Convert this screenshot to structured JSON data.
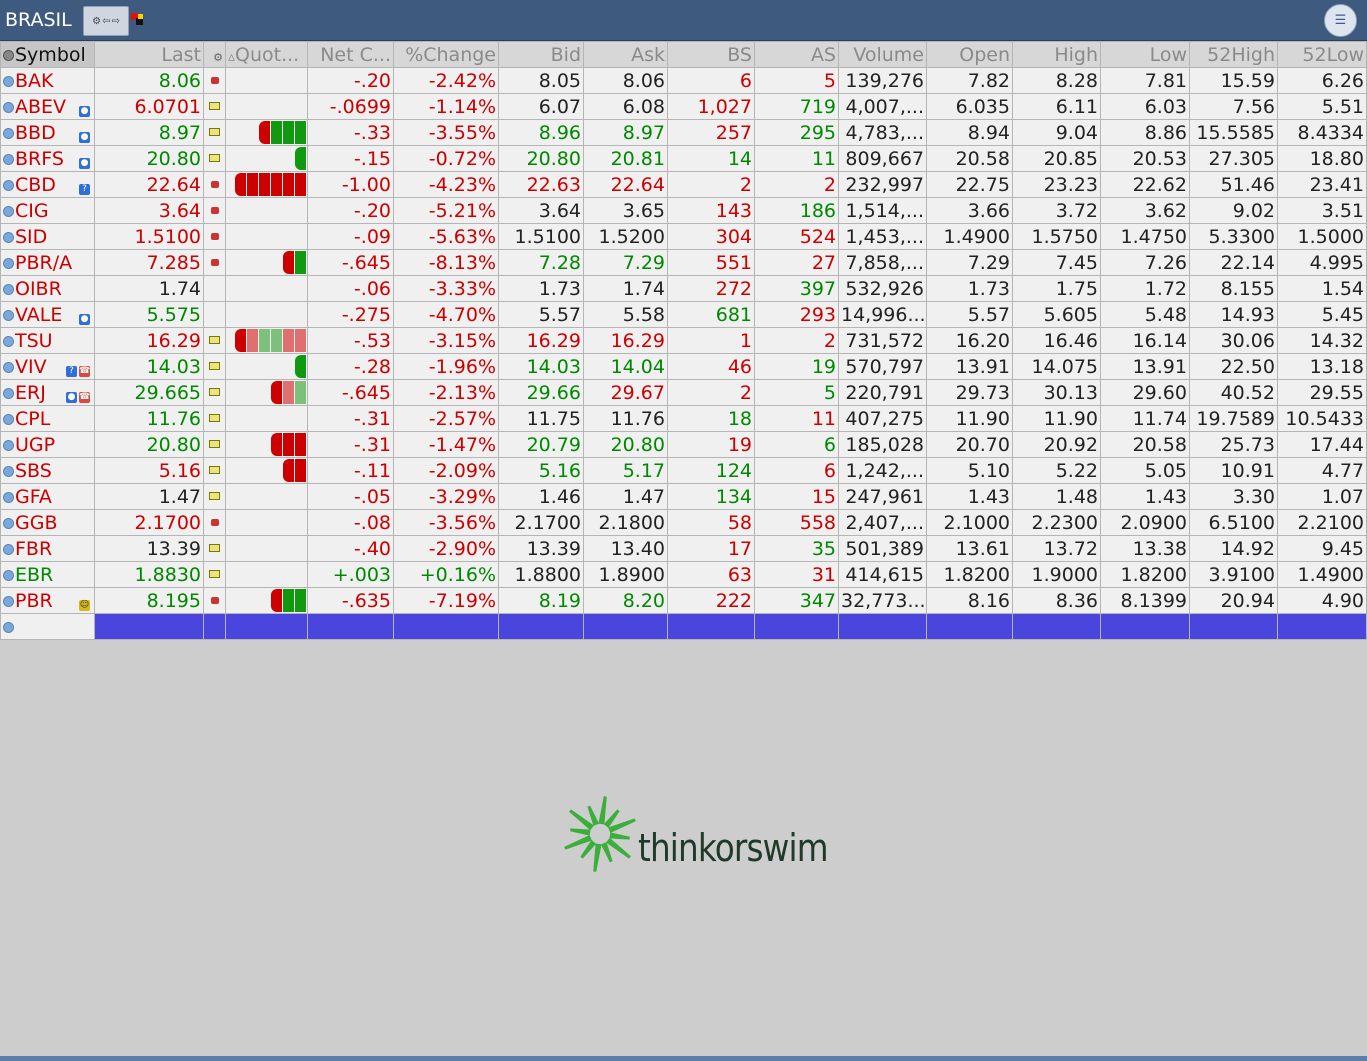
{
  "window": {
    "title": "BRASIL"
  },
  "brand": {
    "logo_text": "thinkorswim",
    "logo_green": "#3cae3c"
  },
  "colors": {
    "title_bar": "#3e5a7e",
    "up": "#008800",
    "down": "#cc0000",
    "selected_row": "#4a45dd"
  },
  "columns": [
    "Symbol",
    "Last",
    "",
    "Quot...",
    "Net C...",
    "%Change",
    "Bid",
    "Ask",
    "BS",
    "AS",
    "Volume",
    "Open",
    "High",
    "Low",
    "52High",
    "52Low"
  ],
  "rows": [
    {
      "symbol": "BAK",
      "sc": "r",
      "badges": [],
      "last": "8.06",
      "lc": "g",
      "rating": "red",
      "bars": [],
      "net": "-.20",
      "pct": "-2.42%",
      "bid": "8.05",
      "bidc": "k",
      "ask": "8.06",
      "askc": "k",
      "bs": "6",
      "bsc": "r",
      "as": "5",
      "asc": "r",
      "vol": "139,276",
      "open": "7.82",
      "high": "8.28",
      "low": "7.81",
      "h52": "15.59",
      "l52": "6.26"
    },
    {
      "symbol": "ABEV",
      "sc": "r",
      "badges": [
        "blue"
      ],
      "last": "6.0701",
      "lc": "r",
      "rating": "yellow",
      "bars": [],
      "net": "-.0699",
      "pct": "-1.14%",
      "bid": "6.07",
      "bidc": "k",
      "ask": "6.08",
      "askc": "k",
      "bs": "1,027",
      "bsc": "r",
      "as": "719",
      "asc": "g",
      "vol": "4,007,...",
      "open": "6.035",
      "high": "6.11",
      "low": "6.03",
      "h52": "7.56",
      "l52": "5.51"
    },
    {
      "symbol": "BBD",
      "sc": "r",
      "badges": [
        "blue"
      ],
      "last": "8.97",
      "lc": "g",
      "rating": "yellow",
      "bars": [
        "#cc0000",
        "#119911",
        "#119911",
        "#119911"
      ],
      "net": "-.33",
      "pct": "-3.55%",
      "bid": "8.96",
      "bidc": "g",
      "ask": "8.97",
      "askc": "g",
      "bs": "257",
      "bsc": "r",
      "as": "295",
      "asc": "g",
      "vol": "4,783,...",
      "open": "8.94",
      "high": "9.04",
      "low": "8.86",
      "h52": "15.5585",
      "l52": "8.4334"
    },
    {
      "symbol": "BRFS",
      "sc": "r",
      "badges": [
        "blue"
      ],
      "last": "20.80",
      "lc": "g",
      "rating": "yellow",
      "bars": [
        "#119911"
      ],
      "net": "-.15",
      "pct": "-0.72%",
      "bid": "20.80",
      "bidc": "g",
      "ask": "20.81",
      "askc": "g",
      "bs": "14",
      "bsc": "g",
      "as": "11",
      "asc": "g",
      "vol": "809,667",
      "open": "20.58",
      "high": "20.85",
      "low": "20.53",
      "h52": "27.305",
      "l52": "18.80"
    },
    {
      "symbol": "CBD",
      "sc": "r",
      "badges": [
        "blue-q"
      ],
      "last": "22.64",
      "lc": "r",
      "rating": "red",
      "bars": [
        "#cc0000",
        "#cc0000",
        "#cc0000",
        "#cc0000",
        "#cc0000",
        "#cc0000"
      ],
      "net": "-1.00",
      "pct": "-4.23%",
      "bid": "22.63",
      "bidc": "r",
      "ask": "22.64",
      "askc": "r",
      "bs": "2",
      "bsc": "r",
      "as": "2",
      "asc": "r",
      "vol": "232,997",
      "open": "22.75",
      "high": "23.23",
      "low": "22.62",
      "h52": "51.46",
      "l52": "23.41"
    },
    {
      "symbol": "CIG",
      "sc": "r",
      "badges": [],
      "last": "3.64",
      "lc": "r",
      "rating": "red",
      "bars": [],
      "net": "-.20",
      "pct": "-5.21%",
      "bid": "3.64",
      "bidc": "k",
      "ask": "3.65",
      "askc": "k",
      "bs": "143",
      "bsc": "r",
      "as": "186",
      "asc": "g",
      "vol": "1,514,...",
      "open": "3.66",
      "high": "3.72",
      "low": "3.62",
      "h52": "9.02",
      "l52": "3.51"
    },
    {
      "symbol": "SID",
      "sc": "r",
      "badges": [],
      "last": "1.5100",
      "lc": "r",
      "rating": "red",
      "bars": [],
      "net": "-.09",
      "pct": "-5.63%",
      "bid": "1.5100",
      "bidc": "k",
      "ask": "1.5200",
      "askc": "k",
      "bs": "304",
      "bsc": "r",
      "as": "524",
      "asc": "r",
      "vol": "1,453,...",
      "open": "1.4900",
      "high": "1.5750",
      "low": "1.4750",
      "h52": "5.3300",
      "l52": "1.5000"
    },
    {
      "symbol": "PBR/A",
      "sc": "r",
      "badges": [],
      "last": "7.285",
      "lc": "r",
      "rating": "red",
      "bars": [
        "#cc0000",
        "#119911"
      ],
      "net": "-.645",
      "pct": "-8.13%",
      "bid": "7.28",
      "bidc": "g",
      "ask": "7.29",
      "askc": "g",
      "bs": "551",
      "bsc": "r",
      "as": "27",
      "asc": "r",
      "vol": "7,858,...",
      "open": "7.29",
      "high": "7.45",
      "low": "7.26",
      "h52": "22.14",
      "l52": "4.995"
    },
    {
      "symbol": "OIBR",
      "sc": "r",
      "badges": [],
      "last": "1.74",
      "lc": "k",
      "rating": "",
      "bars": [],
      "net": "-.06",
      "pct": "-3.33%",
      "bid": "1.73",
      "bidc": "k",
      "ask": "1.74",
      "askc": "k",
      "bs": "272",
      "bsc": "r",
      "as": "397",
      "asc": "g",
      "vol": "532,926",
      "open": "1.73",
      "high": "1.75",
      "low": "1.72",
      "h52": "8.155",
      "l52": "1.54"
    },
    {
      "symbol": "VALE",
      "sc": "r",
      "badges": [
        "blue"
      ],
      "last": "5.575",
      "lc": "g",
      "rating": "",
      "bars": [],
      "net": "-.275",
      "pct": "-4.70%",
      "bid": "5.57",
      "bidc": "k",
      "ask": "5.58",
      "askc": "k",
      "bs": "681",
      "bsc": "g",
      "as": "293",
      "asc": "r",
      "vol": "14,996...",
      "open": "5.57",
      "high": "5.605",
      "low": "5.48",
      "h52": "14.93",
      "l52": "5.45"
    },
    {
      "symbol": "TSU",
      "sc": "r",
      "badges": [],
      "last": "16.29",
      "lc": "r",
      "rating": "yellow",
      "bars": [
        "#cc0000",
        "#e07070",
        "#7cc07c",
        "#7cc07c",
        "#e07070",
        "#e07070"
      ],
      "net": "-.53",
      "pct": "-3.15%",
      "bid": "16.29",
      "bidc": "r",
      "ask": "16.29",
      "askc": "r",
      "bs": "1",
      "bsc": "r",
      "as": "2",
      "asc": "r",
      "vol": "731,572",
      "open": "16.20",
      "high": "16.46",
      "low": "16.14",
      "h52": "30.06",
      "l52": "14.32"
    },
    {
      "symbol": "VIV",
      "sc": "r",
      "badges": [
        "blue-q",
        "red"
      ],
      "last": "14.03",
      "lc": "g",
      "rating": "yellow",
      "bars": [
        "#119911"
      ],
      "net": "-.28",
      "pct": "-1.96%",
      "bid": "14.03",
      "bidc": "g",
      "ask": "14.04",
      "askc": "g",
      "bs": "46",
      "bsc": "r",
      "as": "19",
      "asc": "g",
      "vol": "570,797",
      "open": "13.91",
      "high": "14.075",
      "low": "13.91",
      "h52": "22.50",
      "l52": "13.18"
    },
    {
      "symbol": "ERJ",
      "sc": "r",
      "badges": [
        "blue",
        "red"
      ],
      "last": "29.665",
      "lc": "g",
      "rating": "yellow",
      "bars": [
        "#cc0000",
        "#e07070",
        "#7cc07c"
      ],
      "net": "-.645",
      "pct": "-2.13%",
      "bid": "29.66",
      "bidc": "g",
      "ask": "29.67",
      "askc": "r",
      "bs": "2",
      "bsc": "r",
      "as": "5",
      "asc": "g",
      "vol": "220,791",
      "open": "29.73",
      "high": "30.13",
      "low": "29.60",
      "h52": "40.52",
      "l52": "29.55"
    },
    {
      "symbol": "CPL",
      "sc": "r",
      "badges": [],
      "last": "11.76",
      "lc": "g",
      "rating": "yellow",
      "bars": [],
      "net": "-.31",
      "pct": "-2.57%",
      "bid": "11.75",
      "bidc": "k",
      "ask": "11.76",
      "askc": "k",
      "bs": "18",
      "bsc": "g",
      "as": "11",
      "asc": "r",
      "vol": "407,275",
      "open": "11.90",
      "high": "11.90",
      "low": "11.74",
      "h52": "19.7589",
      "l52": "10.5433"
    },
    {
      "symbol": "UGP",
      "sc": "r",
      "badges": [],
      "last": "20.80",
      "lc": "g",
      "rating": "yellow",
      "bars": [
        "#cc0000",
        "#cc0000",
        "#cc0000"
      ],
      "net": "-.31",
      "pct": "-1.47%",
      "bid": "20.79",
      "bidc": "g",
      "ask": "20.80",
      "askc": "g",
      "bs": "19",
      "bsc": "r",
      "as": "6",
      "asc": "g",
      "vol": "185,028",
      "open": "20.70",
      "high": "20.92",
      "low": "20.58",
      "h52": "25.73",
      "l52": "17.44"
    },
    {
      "symbol": "SBS",
      "sc": "r",
      "badges": [],
      "last": "5.16",
      "lc": "r",
      "rating": "yellow",
      "bars": [
        "#cc0000",
        "#cc0000"
      ],
      "net": "-.11",
      "pct": "-2.09%",
      "bid": "5.16",
      "bidc": "g",
      "ask": "5.17",
      "askc": "g",
      "bs": "124",
      "bsc": "g",
      "as": "6",
      "asc": "r",
      "vol": "1,242,...",
      "open": "5.10",
      "high": "5.22",
      "low": "5.05",
      "h52": "10.91",
      "l52": "4.77"
    },
    {
      "symbol": "GFA",
      "sc": "r",
      "badges": [],
      "last": "1.47",
      "lc": "k",
      "rating": "yellow",
      "bars": [],
      "net": "-.05",
      "pct": "-3.29%",
      "bid": "1.46",
      "bidc": "k",
      "ask": "1.47",
      "askc": "k",
      "bs": "134",
      "bsc": "g",
      "as": "15",
      "asc": "r",
      "vol": "247,961",
      "open": "1.43",
      "high": "1.48",
      "low": "1.43",
      "h52": "3.30",
      "l52": "1.07"
    },
    {
      "symbol": "GGB",
      "sc": "r",
      "badges": [],
      "last": "2.1700",
      "lc": "r",
      "rating": "red",
      "bars": [],
      "net": "-.08",
      "pct": "-3.56%",
      "bid": "2.1700",
      "bidc": "k",
      "ask": "2.1800",
      "askc": "k",
      "bs": "58",
      "bsc": "r",
      "as": "558",
      "asc": "r",
      "vol": "2,407,...",
      "open": "2.1000",
      "high": "2.2300",
      "low": "2.0900",
      "h52": "6.5100",
      "l52": "2.2100"
    },
    {
      "symbol": "FBR",
      "sc": "r",
      "badges": [],
      "last": "13.39",
      "lc": "k",
      "rating": "yellow",
      "bars": [],
      "net": "-.40",
      "pct": "-2.90%",
      "bid": "13.39",
      "bidc": "k",
      "ask": "13.40",
      "askc": "k",
      "bs": "17",
      "bsc": "r",
      "as": "35",
      "asc": "g",
      "vol": "501,389",
      "open": "13.61",
      "high": "13.72",
      "low": "13.38",
      "h52": "14.92",
      "l52": "9.45"
    },
    {
      "symbol": "EBR",
      "sc": "g",
      "badges": [],
      "last": "1.8830",
      "lc": "g",
      "rating": "yellow",
      "bars": [],
      "net": "+.003",
      "pct": "+0.16%",
      "netc": "g",
      "bid": "1.8800",
      "bidc": "k",
      "ask": "1.8900",
      "askc": "k",
      "bs": "63",
      "bsc": "r",
      "as": "31",
      "asc": "r",
      "vol": "414,615",
      "open": "1.8200",
      "high": "1.9000",
      "low": "1.8200",
      "h52": "3.9100",
      "l52": "1.4900"
    },
    {
      "symbol": "PBR",
      "sc": "r",
      "badges": [
        "yellow"
      ],
      "last": "8.195",
      "lc": "g",
      "rating": "red",
      "bars": [
        "#cc0000",
        "#119911",
        "#119911"
      ],
      "net": "-.635",
      "pct": "-7.19%",
      "bid": "8.19",
      "bidc": "g",
      "ask": "8.20",
      "askc": "g",
      "bs": "222",
      "bsc": "r",
      "as": "347",
      "asc": "g",
      "vol": "32,773...",
      "open": "8.16",
      "high": "8.36",
      "low": "8.1399",
      "h52": "20.94",
      "l52": "4.90"
    }
  ]
}
